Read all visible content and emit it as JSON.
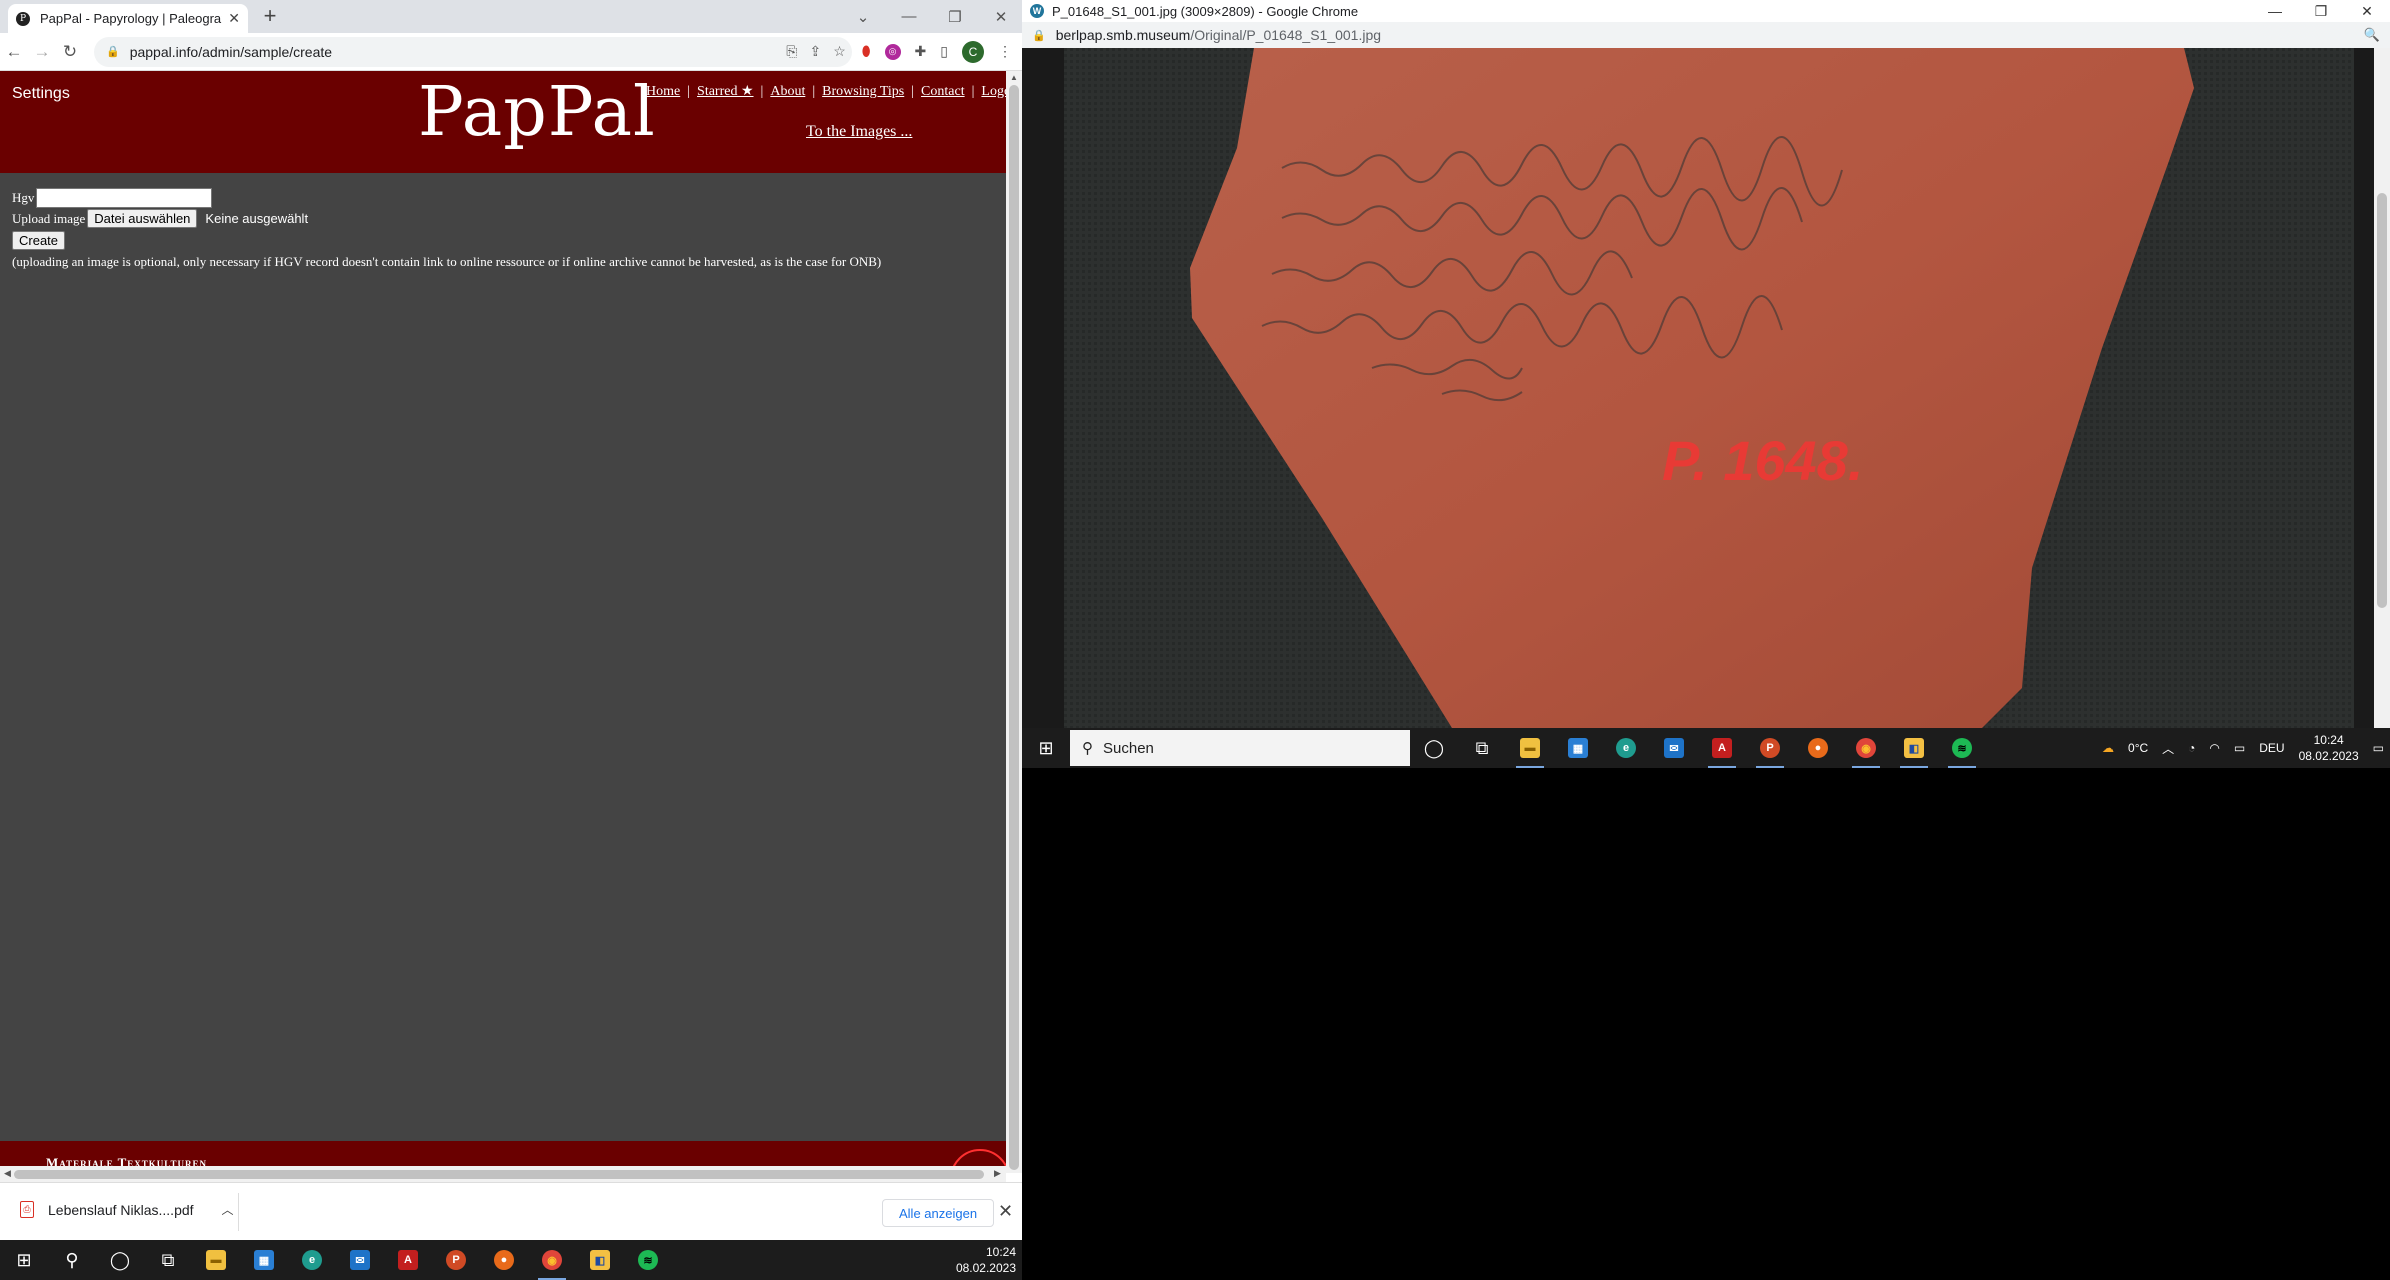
{
  "left_browser": {
    "tab_title": "PapPal - Papyrology | Paleograph",
    "tab_favicon": "P",
    "url": "pappal.info/admin/sample/create",
    "avatar_letter": "C"
  },
  "site": {
    "settings": "Settings",
    "logo": "PapPal",
    "nav": [
      "Home",
      "Starred ★",
      "About",
      "Browsing Tips",
      "Contact",
      "Logout"
    ],
    "to_images": "To the Images ...",
    "form": {
      "hgv_label": "Hgv",
      "upload_label": "Upload image",
      "file_button": "Datei auswählen",
      "no_file": "Keine ausgewählt",
      "create_button": "Create",
      "note": "(uploading an image is optional, only necessary if HGV record doesn't contain link to online ressource or if online archive cannot be harvested, as is the case for ONB)"
    },
    "footer_text": "Materiale Textkulturen"
  },
  "downloads": {
    "file": "Lebenslauf Niklas....pdf",
    "show_all": "Alle anzeigen"
  },
  "right_browser": {
    "title": "P_01648_S1_001.jpg (3009×2809) - Google Chrome",
    "url_host": "berlpap.smb.museum",
    "url_path": "/Original/P_01648_S1_001.jpg",
    "ostracon_label": "P. 1648."
  },
  "taskbar": {
    "search_placeholder": "Suchen",
    "weather": "0°C",
    "language": "DEU",
    "time": "10:24",
    "date": "08.02.2023"
  },
  "colors": {
    "header_bg": "#6a0000",
    "page_bg": "#444444",
    "ostracon": "#b5553e",
    "ostracon_label": "#e83a35"
  }
}
